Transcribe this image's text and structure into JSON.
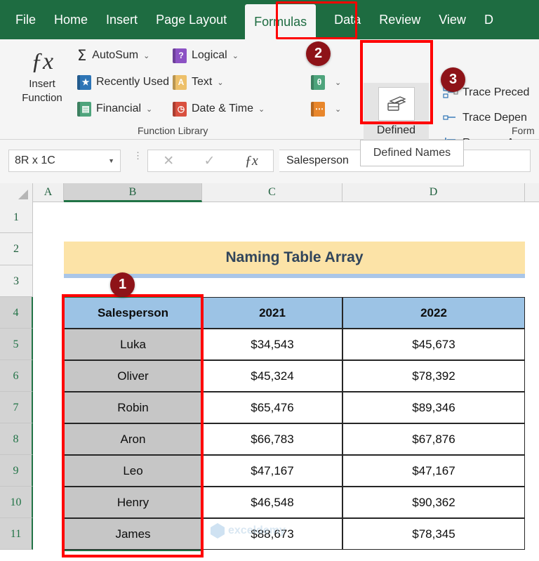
{
  "ribbon": {
    "tabs": [
      {
        "label": "File",
        "active": false
      },
      {
        "label": "Home",
        "active": false
      },
      {
        "label": "Insert",
        "active": false
      },
      {
        "label": "Page Layout",
        "active": false
      },
      {
        "label": "Formulas",
        "active": true
      },
      {
        "label": "Data",
        "active": false
      },
      {
        "label": "Review",
        "active": false
      },
      {
        "label": "View",
        "active": false
      },
      {
        "label": "D",
        "active": false
      }
    ],
    "insert_function": {
      "icon": "fx-icon",
      "line1": "Insert",
      "line2": "Function"
    },
    "function_library": {
      "group_label": "Function Library",
      "items": [
        {
          "label": "AutoSum",
          "icon": "sigma-icon",
          "color": "#2B2B2B",
          "chevron": "ˇ"
        },
        {
          "label": "Recently Used",
          "icon": "star-book-icon",
          "color": "#2E75B6",
          "glyph": "★",
          "chevron": "ˇ"
        },
        {
          "label": "Financial",
          "icon": "financial-book-icon",
          "color": "#4EA47C",
          "glyph": "▤",
          "chevron": "ˇ"
        },
        {
          "label": "Logical",
          "icon": "logical-book-icon",
          "color": "#8C52C4",
          "glyph": "?",
          "chevron": "ˇ"
        },
        {
          "label": "Text",
          "icon": "text-book-icon",
          "color": "#EDC06A",
          "glyph": "A",
          "chevron": "ˇ"
        },
        {
          "label": "Date & Time",
          "icon": "date-time-book-icon",
          "color": "#D9503F",
          "glyph": "◷",
          "chevron": "ˇ"
        },
        {
          "label": "",
          "icon": "lookup-reference-book-icon",
          "color": "#4EA47C",
          "glyph": "θ",
          "chevron": "ˇ"
        },
        {
          "label": "",
          "icon": "more-functions-book-icon",
          "color": "#E8862B",
          "glyph": "⋯",
          "chevron": "ˇ"
        }
      ]
    },
    "defined_names": {
      "icon": "defined-names-icon",
      "line1": "Defined",
      "line2": "Names",
      "chevron": "ˇ",
      "tooltip": "Defined Names"
    },
    "formula_auditing": {
      "group_label": "Form",
      "items": [
        {
          "label": "Trace Preced",
          "icon": "trace-precedents-icon"
        },
        {
          "label": "Trace Depen",
          "icon": "trace-dependents-icon"
        },
        {
          "label": "Remove Arro",
          "icon": "remove-arrows-icon"
        }
      ]
    }
  },
  "callouts": [
    {
      "number": "1"
    },
    {
      "number": "2"
    },
    {
      "number": "3"
    }
  ],
  "formula_bar": {
    "name_box_value": "8R x 1C",
    "name_box_arrow": "▼",
    "cancel_icon": "✕",
    "enter_icon": "✓",
    "insert_function_icon": "fx",
    "content": "Salesperson"
  },
  "grid": {
    "columns": [
      "A",
      "B",
      "C",
      "D"
    ],
    "selected_column": "B",
    "rows": [
      "1",
      "2",
      "3",
      "4",
      "5",
      "6",
      "7",
      "8",
      "9",
      "10",
      "11"
    ],
    "selected_rows": [
      "4",
      "5",
      "6",
      "7",
      "8",
      "9",
      "10",
      "11"
    ]
  },
  "sheet": {
    "title_banner": "Naming Table Array",
    "table": {
      "headers": [
        "Salesperson",
        "2021",
        "2022"
      ],
      "rows": [
        [
          "Luka",
          "$34,543",
          "$45,673"
        ],
        [
          "Oliver",
          "$45,324",
          "$78,392"
        ],
        [
          "Robin",
          "$65,476",
          "$89,346"
        ],
        [
          "Aron",
          "$66,783",
          "$67,876"
        ],
        [
          "Leo",
          "$47,167",
          "$47,167"
        ],
        [
          "Henry",
          "$46,548",
          "$90,362"
        ],
        [
          "James",
          "$88,673",
          "$78,345"
        ]
      ]
    }
  },
  "watermark": {
    "text": "exceldemy"
  },
  "colors": {
    "ribbon_green": "#1E6C41",
    "excel_green": "#217346",
    "highlight_red": "#FF0000",
    "badge_red": "#8E1318",
    "header_blue": "#9CC3E5",
    "name_gray": "#C6C6C6",
    "title_yellow": "#FCE3A7",
    "title_underline_blue": "#A9C6E8"
  }
}
